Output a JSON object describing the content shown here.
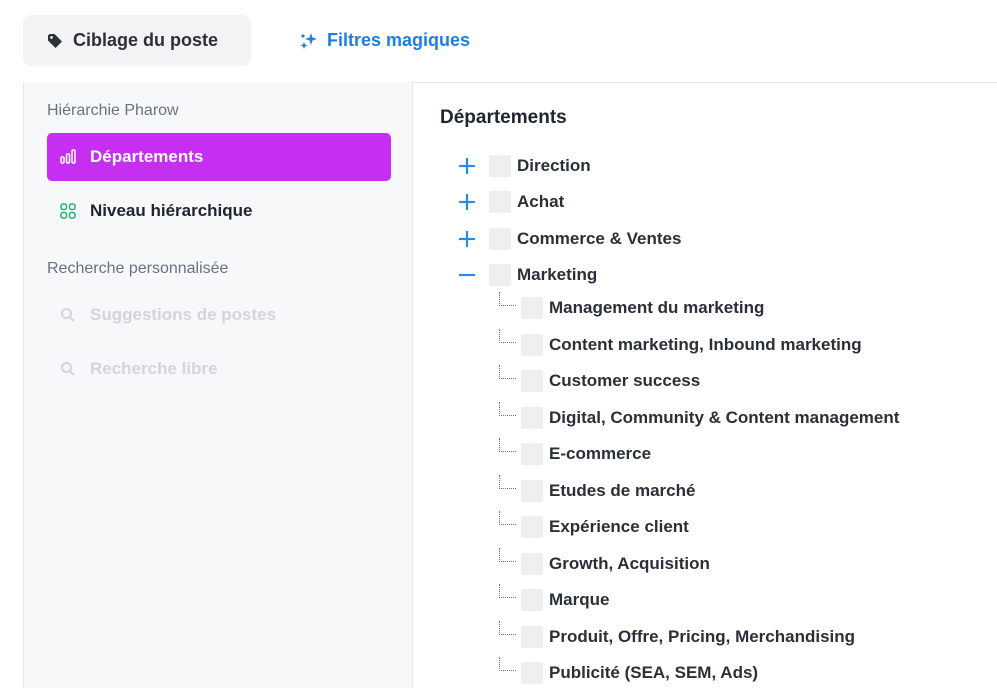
{
  "tabs": {
    "job_targeting": {
      "label": "Ciblage du poste",
      "icon": "tag-icon"
    },
    "magic_filters": {
      "label": "Filtres magiques",
      "icon": "sparkles-icon"
    }
  },
  "sidebar": {
    "section1_title": "Hiérarchie Pharow",
    "departments": {
      "label": "Départements",
      "icon": "bar-chart-icon"
    },
    "level": {
      "label": "Niveau hiérarchique",
      "icon": "grid-icon"
    },
    "section2_title": "Recherche personnalisée",
    "suggestions": {
      "label": "Suggestions de postes",
      "icon": "search-icon"
    },
    "free_search": {
      "label": "Recherche libre",
      "icon": "search-icon"
    }
  },
  "main": {
    "title": "Départements",
    "departments": [
      {
        "label": "Direction",
        "expanded": false
      },
      {
        "label": "Achat",
        "expanded": false
      },
      {
        "label": "Commerce & Ventes",
        "expanded": false
      },
      {
        "label": "Marketing",
        "expanded": true
      }
    ],
    "marketing_children": [
      "Management du marketing",
      "Content marketing, Inbound marketing",
      "Customer success",
      "Digital, Community & Content management",
      "E-commerce",
      "Etudes de marché",
      "Expérience client",
      "Growth, Acquisition",
      "Marque",
      "Produit, Offre, Pricing, Merchandising",
      "Publicité (SEA, SEM, Ads)"
    ]
  },
  "colors": {
    "accent": "#c62ef2",
    "link_blue": "#1f7fe0",
    "toggle_blue": "#2a8be0"
  }
}
